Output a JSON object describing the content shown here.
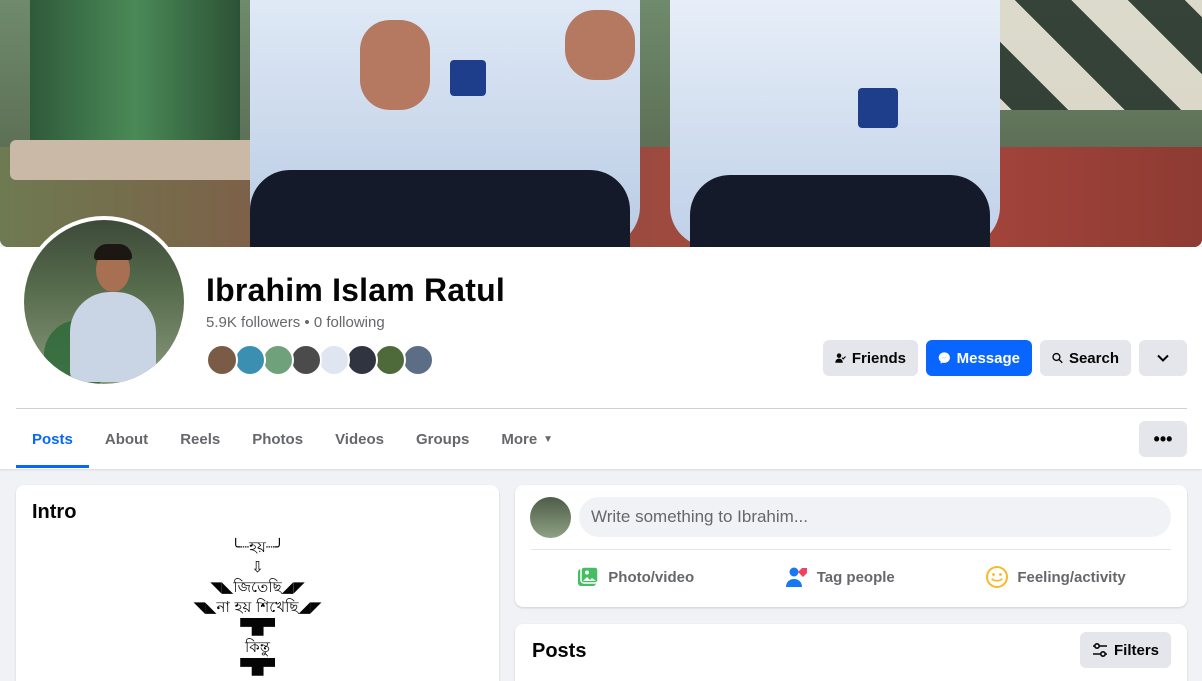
{
  "profile": {
    "name": "Ibrahim Islam Ratul",
    "followers": "5.9K followers",
    "separator": " • ",
    "following": "0 following"
  },
  "header_buttons": {
    "friends": "Friends",
    "message": "Message",
    "search": "Search"
  },
  "friend_avatars": [
    {
      "color": "#7a5b45"
    },
    {
      "color": "#3b8fb0"
    },
    {
      "color": "#6fa27a"
    },
    {
      "color": "#4b4b4b"
    },
    {
      "color": "#dfe6f2"
    },
    {
      "color": "#2f3440"
    },
    {
      "color": "#4f6a3a"
    },
    {
      "color": "#5b6e86"
    }
  ],
  "tabs": [
    {
      "label": "Posts"
    },
    {
      "label": "About"
    },
    {
      "label": "Reels"
    },
    {
      "label": "Photos"
    },
    {
      "label": "Videos"
    },
    {
      "label": "Groups"
    },
    {
      "label": "More"
    }
  ],
  "intro": {
    "title": "Intro",
    "bio": "╰┈হয়┈╯\n⇩\n◥◣জিতেছি◢◤\n◥◣না হয় শিখেছি◢◤\n▀█▀\nকিন্তু\n▀█▀"
  },
  "composer": {
    "placeholder": "Write something to Ibrahim...",
    "actions": {
      "photo": "Photo/video",
      "tag": "Tag people",
      "feeling": "Feeling/activity"
    }
  },
  "posts": {
    "title": "Posts",
    "filters": "Filters"
  },
  "colors": {
    "accent": "#0866ff",
    "photo_green": "#45bd62",
    "tag_blue": "#1877f2",
    "feeling_yellow": "#f7b928"
  }
}
